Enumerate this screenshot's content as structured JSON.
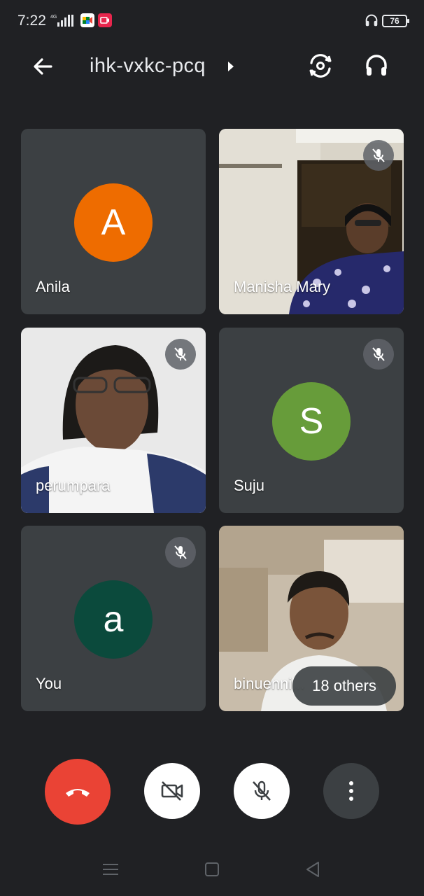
{
  "status_bar": {
    "time": "7:22",
    "battery": "76"
  },
  "meeting": {
    "code": "ihk-vxkc-pcq"
  },
  "participants": [
    {
      "name": "Anila",
      "initial": "A",
      "avatar_color": "#ee6c00",
      "muted": false,
      "video": false
    },
    {
      "name": "Manisha Mary",
      "initial": "",
      "muted": true,
      "video": true
    },
    {
      "name": "perumpara",
      "initial": "",
      "muted": true,
      "video": true
    },
    {
      "name": "Suju",
      "initial": "S",
      "avatar_color": "#679c3a",
      "muted": true,
      "video": false
    },
    {
      "name": "You",
      "initial": "a",
      "avatar_color": "#0b4a3c",
      "muted": true,
      "video": false
    },
    {
      "name": "binuenni...",
      "initial": "",
      "muted": false,
      "video": true
    }
  ],
  "others_label": "18 others",
  "controls": {
    "end_call": "end-call-icon",
    "camera": "camera-off-icon",
    "mic": "mic-off-icon",
    "more": "more-vert-icon"
  },
  "colors": {
    "background": "#202124",
    "tile": "#3c4043",
    "end_call": "#ea4335"
  }
}
